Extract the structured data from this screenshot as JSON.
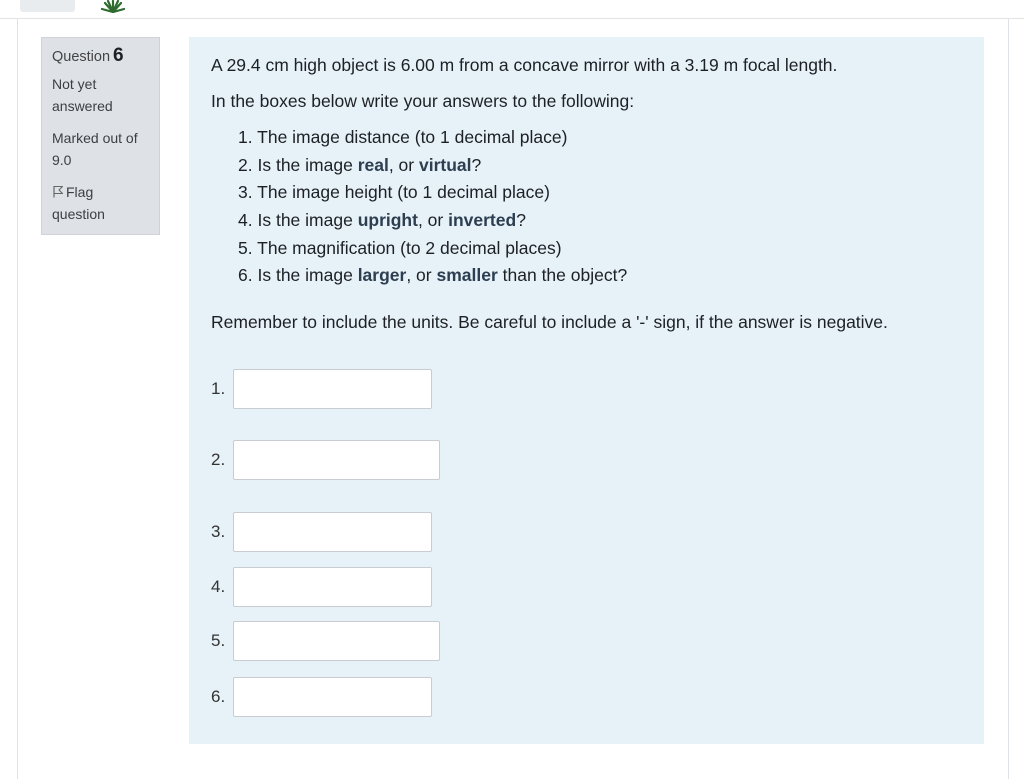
{
  "nav": {
    "logo_icon": "leaf-logo-icon"
  },
  "info": {
    "question_label": "Question",
    "question_number": "6",
    "state_line1": "Not yet",
    "state_line2": "answered",
    "grade_line1": "Marked out of",
    "grade_line2": "9.0",
    "flag_icon": "flag-outline-icon",
    "flag_line1": "Flag",
    "flag_line2": "question"
  },
  "question": {
    "text": "A 29.4 cm high object is 6.00 m from a concave mirror with a 3.19 m focal length.",
    "instruction": "In the boxes below write your answers to the following:",
    "items": [
      {
        "num": "1.",
        "pre": "The image distance (to 1 decimal place)"
      },
      {
        "num": "2.",
        "pre": "Is the image ",
        "b1": "real",
        "mid": ", or ",
        "b2": "virtual",
        "post": "?"
      },
      {
        "num": "3.",
        "pre": "The image height (to 1 decimal place)"
      },
      {
        "num": "4.",
        "pre": "Is the image ",
        "b1": "upright",
        "mid": ", or ",
        "b2": "inverted",
        "post": "?"
      },
      {
        "num": "5.",
        "pre": "The magnification (to 2 decimal places)"
      },
      {
        "num": "6.",
        "pre": "Is the image ",
        "b1": "larger",
        "mid": ", or ",
        "b2": "smaller",
        "post": " than the object?"
      }
    ],
    "remember": "Remember to include the units. Be careful to include a '-' sign, if the answer is negative."
  },
  "answers": [
    {
      "label": "1.",
      "value": ""
    },
    {
      "label": "2.",
      "value": ""
    },
    {
      "label": "3.",
      "value": ""
    },
    {
      "label": "4.",
      "value": ""
    },
    {
      "label": "5.",
      "value": ""
    },
    {
      "label": "6.",
      "value": ""
    }
  ],
  "colors": {
    "content_bg": "#e6f1f8",
    "info_bg": "#dee2e6",
    "logo_green": "#2e6b2f"
  }
}
